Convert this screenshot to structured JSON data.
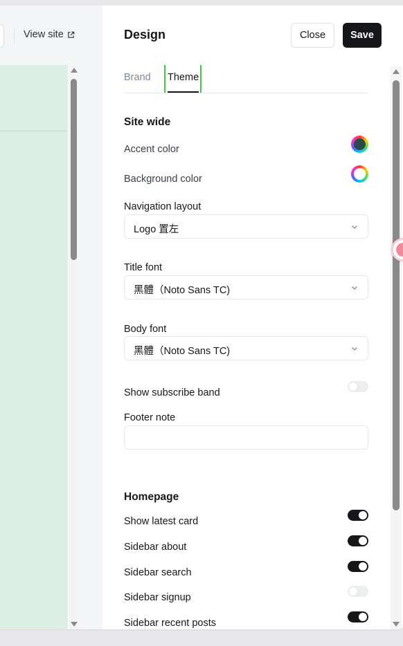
{
  "header": {
    "view_site": "View site"
  },
  "panel": {
    "title": "Design",
    "close_label": "Close",
    "save_label": "Save",
    "tabs": [
      {
        "label": "Brand",
        "active": false
      },
      {
        "label": "Theme",
        "active": true
      }
    ]
  },
  "site_wide": {
    "title": "Site wide",
    "accent_color_label": "Accent color",
    "accent_color": "#15171a",
    "background_color_label": "Background color",
    "background_color": "#ffffff",
    "navigation_layout_label": "Navigation layout",
    "navigation_layout_value": "Logo 置左",
    "title_font_label": "Title font",
    "title_font_value": "黑體（Noto Sans TC)",
    "body_font_label": "Body font",
    "body_font_value": "黑體（Noto Sans TC)",
    "show_subscribe_band_label": "Show subscribe band",
    "show_subscribe_band": false,
    "footer_note_label": "Footer note",
    "footer_note_value": ""
  },
  "homepage": {
    "title": "Homepage",
    "items": [
      {
        "label": "Show latest card",
        "on": true
      },
      {
        "label": "Sidebar about",
        "on": true
      },
      {
        "label": "Sidebar search",
        "on": true
      },
      {
        "label": "Sidebar signup",
        "on": false
      },
      {
        "label": "Sidebar recent posts",
        "on": true
      }
    ]
  },
  "colors": {
    "preview_bg": "#ddeee4",
    "primary_button": "#15171a",
    "tab_highlight": "#3ecf3e"
  },
  "icons": {
    "external_link": "external-link-icon",
    "chevron": "chevron-down-icon"
  }
}
